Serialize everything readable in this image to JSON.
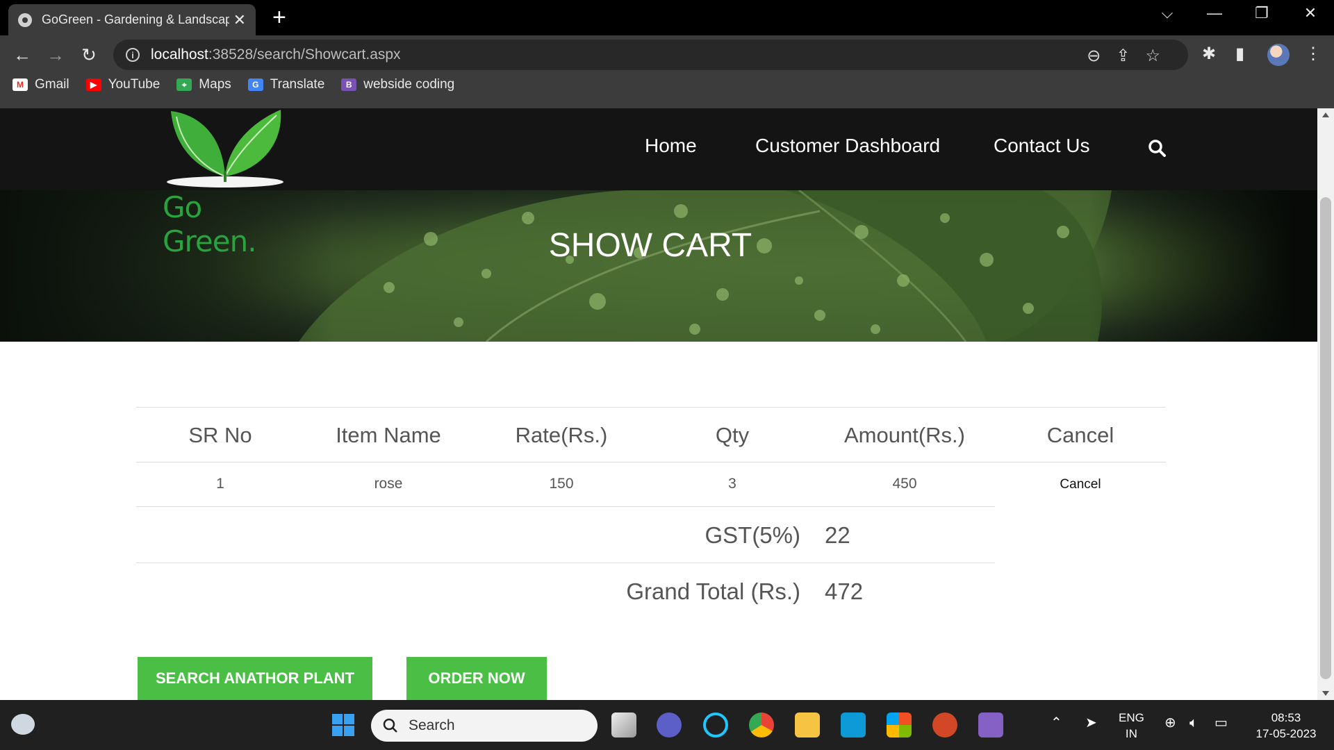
{
  "browser": {
    "tab_title": "GoGreen - Gardening & Landscaping",
    "new_tab": "+",
    "url_host": "localhost",
    "url_path": ":38528/search/Showcart.aspx",
    "bookmarks": [
      {
        "label": "Gmail",
        "icon": "gmail-icon"
      },
      {
        "label": "YouTube",
        "icon": "youtube-icon"
      },
      {
        "label": "Maps",
        "icon": "maps-icon"
      },
      {
        "label": "Translate",
        "icon": "translate-icon"
      },
      {
        "label": "webside coding",
        "icon": "bootstrap-icon"
      }
    ]
  },
  "site": {
    "logo_text": "Go Green.",
    "nav": [
      "Home",
      "Customer Dashboard",
      "Contact Us"
    ],
    "hero_title": "SHOW CART"
  },
  "cart": {
    "headers": [
      "SR No",
      "Item Name",
      "Rate(Rs.)",
      "Qty",
      "Amount(Rs.)",
      "Cancel"
    ],
    "rows": [
      {
        "sr": "1",
        "item": "rose",
        "rate": "150",
        "qty": "3",
        "amount": "450",
        "cancel": "Cancel"
      }
    ],
    "gst_label": "GST(5%)",
    "gst_value": "22",
    "grand_total_label": "Grand Total (Rs.)",
    "grand_total_value": "472"
  },
  "buttons": {
    "search_another": "SEARCH ANATHOR PLANT",
    "order_now": "ORDER NOW"
  },
  "taskbar": {
    "search_placeholder": "Search",
    "lang_top": "ENG",
    "lang_bottom": "IN",
    "time": "08:53",
    "date": "17-05-2023"
  },
  "colors": {
    "accent_green": "#4bbf45",
    "nav_bg": "#141414",
    "browser_bg": "#3c3c3c"
  }
}
